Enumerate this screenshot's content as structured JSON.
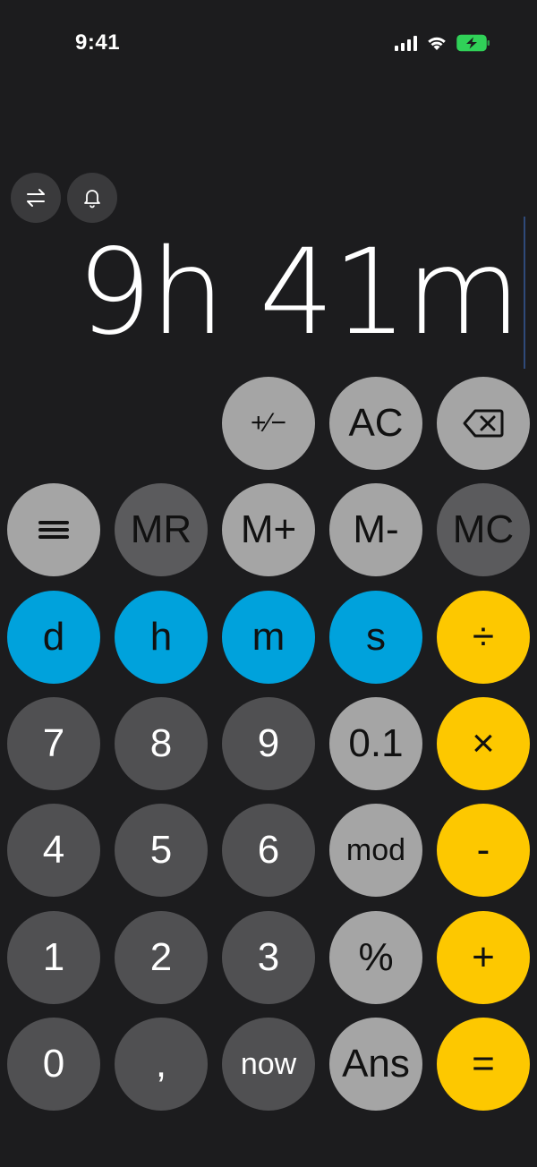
{
  "status_bar": {
    "time": "9:41",
    "icons": [
      "cellular-signal-icon",
      "wifi-icon",
      "battery-charging-icon"
    ],
    "battery_color": "#30d158"
  },
  "top_buttons": [
    {
      "icon": "swap-arrows-icon"
    },
    {
      "icon": "bell-icon"
    }
  ],
  "display": {
    "value": "9h 41m"
  },
  "keys": {
    "plus_minus": "+⁄−",
    "clear": "AC",
    "backspace_icon": "delete-left-icon",
    "menu_icon": "menu-icon",
    "memory_recall": "MR",
    "memory_add": "M+",
    "memory_subtract": "M-",
    "memory_clear": "MC",
    "days": "d",
    "hours": "h",
    "minutes": "m",
    "seconds": "s",
    "divide": "÷",
    "seven": "7",
    "eight": "8",
    "nine": "9",
    "tenth": "0.1",
    "multiply": "×",
    "four": "4",
    "five": "5",
    "six": "6",
    "mod": "mod",
    "minus": "-",
    "one": "1",
    "two": "2",
    "three": "3",
    "percent": "%",
    "plus": "+",
    "zero": "0",
    "comma": ",",
    "now": "now",
    "answer": "Ans",
    "equals": "="
  },
  "colors": {
    "background": "#1c1c1e",
    "unit_keys": "#00a2dc",
    "operator_keys": "#fdc800",
    "function_keys": "#a5a5a5",
    "digit_keys": "#505052"
  }
}
